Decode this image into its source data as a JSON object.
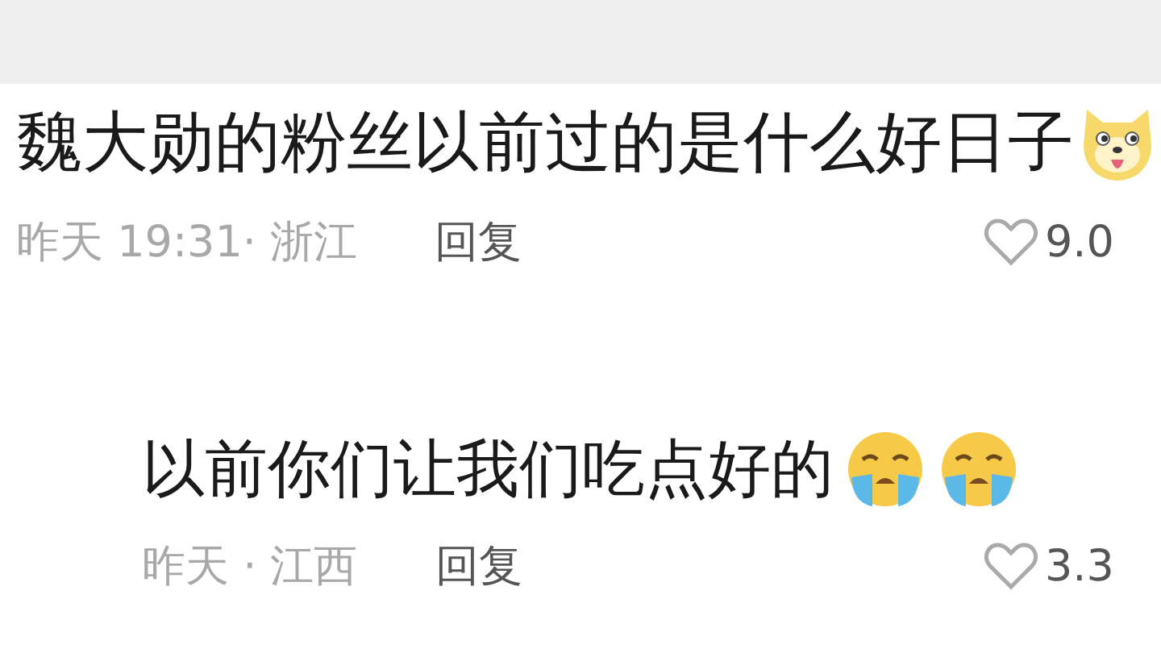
{
  "comments": [
    {
      "text": "魏大勋的粉丝以前过的是什么好日子",
      "emojis": [
        {
          "kind": "dog"
        }
      ],
      "meta": "昨天 19:31· 浙江",
      "reply_label": "回复",
      "likes": "9.0",
      "replies": [
        {
          "text": "以前你们让我们吃点好的",
          "emojis": [
            {
              "kind": "crying"
            },
            {
              "kind": "crying"
            }
          ],
          "meta": "昨天 · 江西",
          "reply_label": "回复",
          "likes": "3.3"
        }
      ]
    }
  ]
}
